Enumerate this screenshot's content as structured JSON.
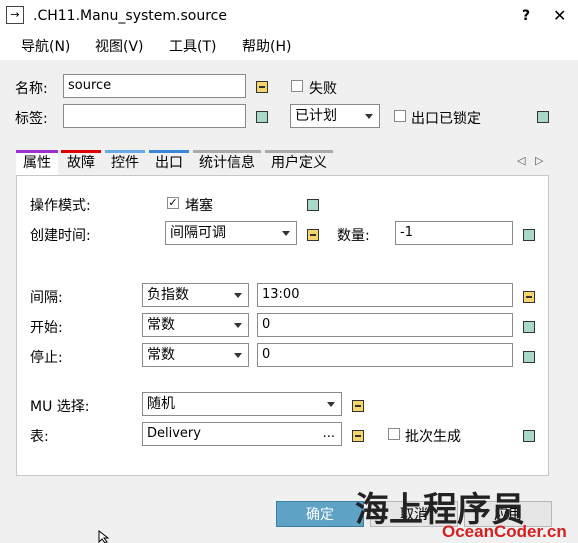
{
  "window": {
    "title": ".CH11.Manu_system.source",
    "help": "?",
    "close": "✕",
    "icon": "→"
  },
  "menu": [
    "导航(N)",
    "视图(V)",
    "工具(T)",
    "帮助(H)"
  ],
  "header": {
    "name_label": "名称:",
    "name_value": "source",
    "failed_label": "失败",
    "tag_label": "标签:",
    "tag_value": "",
    "plan_value": "已计划",
    "exit_locked_label": "出口已锁定"
  },
  "tabs": [
    "属性",
    "故障",
    "控件",
    "出口",
    "统计信息",
    "用户定义"
  ],
  "tab_colors": [
    "#9b30d0",
    "#e00000",
    "#6aa8e6",
    "#3a86d8",
    "#aaaaaa",
    "#aaaaaa"
  ],
  "attrs": {
    "op_mode_label": "操作模式:",
    "blocking_label": "堵塞",
    "create_time_label": "创建时间:",
    "create_time_value": "间隔可调",
    "quantity_label": "数量:",
    "quantity_value": "-1",
    "interval_label": "间隔:",
    "interval_dist": "负指数",
    "interval_value": "13:00",
    "start_label": "开始:",
    "start_dist": "常数",
    "start_value": "0",
    "stop_label": "停止:",
    "stop_dist": "常数",
    "stop_value": "0",
    "mu_label": "MU 选择:",
    "mu_value": "随机",
    "table_label": "表:",
    "table_value": "Delivery",
    "table_dots": "...",
    "batch_label": "批次生成"
  },
  "buttons": {
    "ok": "确定",
    "cancel": "取消",
    "apply": "应用"
  },
  "watermark": {
    "brand": "海上程序员",
    "url": "OceanCoder.cn"
  }
}
